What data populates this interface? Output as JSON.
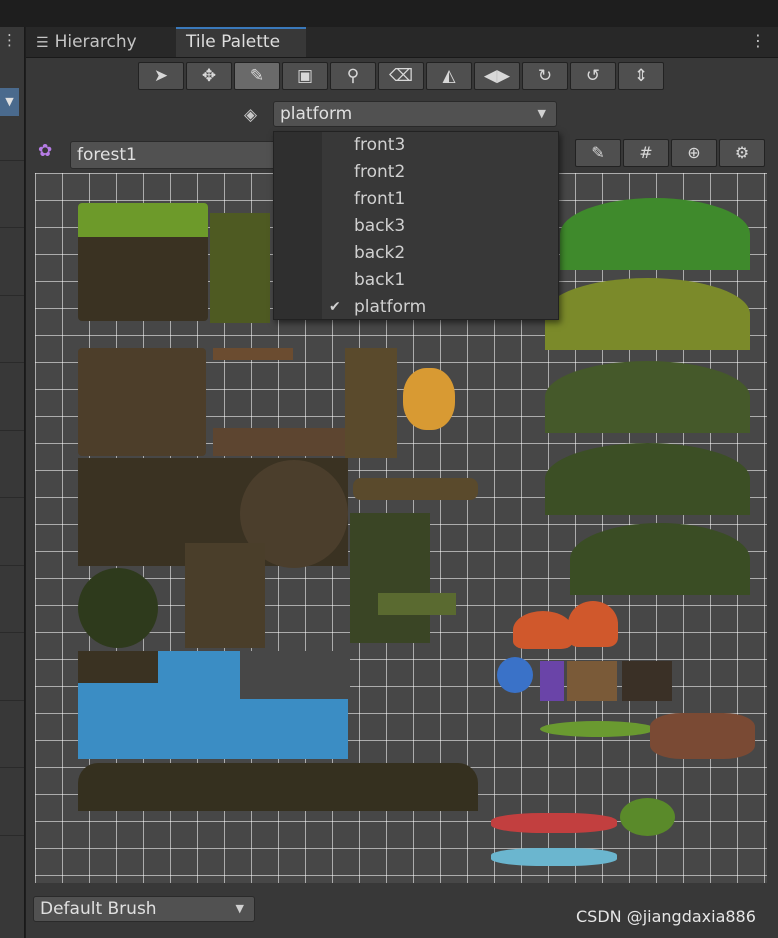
{
  "tabs": {
    "hierarchy": "Hierarchy",
    "tile_palette": "Tile Palette"
  },
  "toolbar": {
    "tools": [
      {
        "name": "select-tool",
        "glyph": "➤"
      },
      {
        "name": "move-tool",
        "glyph": "✥"
      },
      {
        "name": "paint-tool",
        "glyph": "✎"
      },
      {
        "name": "box-fill-tool",
        "glyph": "▣"
      },
      {
        "name": "pick-tool",
        "glyph": "⚲"
      },
      {
        "name": "erase-tool",
        "glyph": "⌫"
      },
      {
        "name": "fill-tool",
        "glyph": "◭"
      },
      {
        "name": "flip-tool",
        "glyph": "◀▶"
      },
      {
        "name": "rotate-cw-tool",
        "glyph": "↻"
      },
      {
        "name": "rotate-ccw-tool",
        "glyph": "↺"
      },
      {
        "name": "flip-vertical-tool",
        "glyph": "⇕"
      }
    ]
  },
  "layer": {
    "selected": "platform"
  },
  "palette": {
    "selected": "forest1"
  },
  "dropdown": {
    "options": [
      "front3",
      "front2",
      "front1",
      "back3",
      "back2",
      "back1",
      "platform"
    ],
    "checked": "platform"
  },
  "brush": {
    "selected": "Default Brush"
  },
  "watermark": "CSDN @jiangdaxia886",
  "colors": {
    "accent": "#3a79bb",
    "panel": "#383838",
    "grid": "#474747"
  }
}
